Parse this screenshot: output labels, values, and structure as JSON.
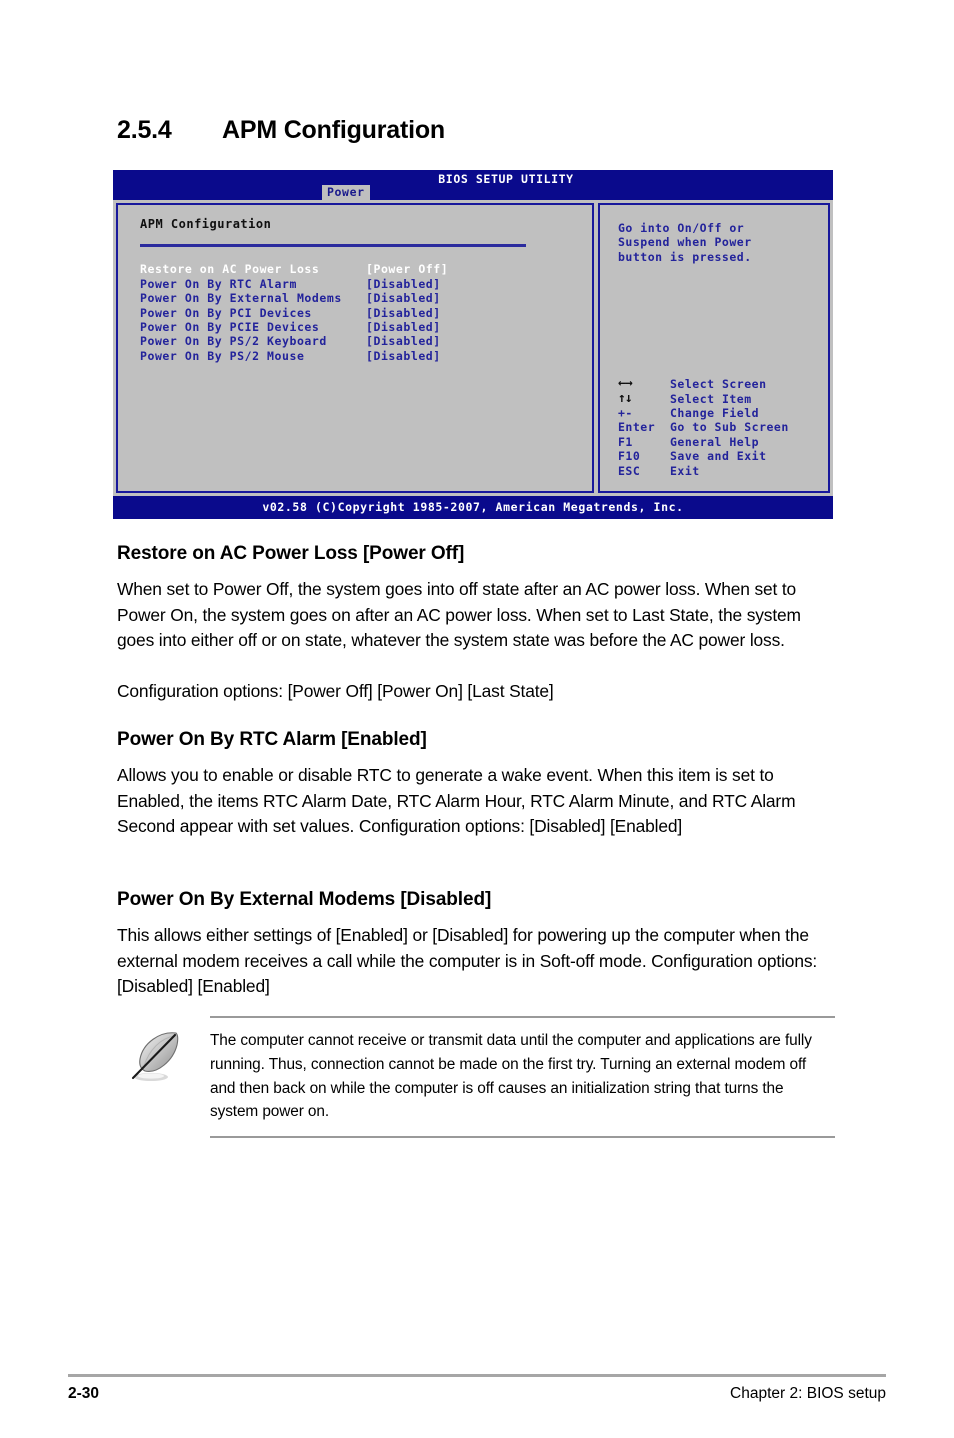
{
  "page": {
    "heading_number": "2.5.4",
    "heading_title": "APM Configuration"
  },
  "bios": {
    "title": "BIOS SETUP UTILITY",
    "tab": "Power",
    "section_title": "APM Configuration",
    "options": [
      {
        "label": "Restore on AC Power Loss",
        "value": "[Power Off]",
        "selected": true
      },
      {
        "label": "Power On By RTC Alarm",
        "value": "[Disabled]",
        "selected": false
      },
      {
        "label": "Power On By External Modems",
        "value": "[Disabled]",
        "selected": false
      },
      {
        "label": "Power On By PCI Devices",
        "value": "[Disabled]",
        "selected": false
      },
      {
        "label": "Power On By PCIE Devices",
        "value": "[Disabled]",
        "selected": false
      },
      {
        "label": "Power On By PS/2 Keyboard",
        "value": "[Disabled]",
        "selected": false
      },
      {
        "label": "Power On By PS/2 Mouse",
        "value": "[Disabled]",
        "selected": false
      }
    ],
    "help_lines": [
      "Go into On/Off or",
      "Suspend when Power",
      "button is pressed."
    ],
    "legend": [
      {
        "key": "←→",
        "desc": "Select Screen",
        "glyph": true
      },
      {
        "key": "↑↓",
        "desc": "Select Item",
        "glyph": true
      },
      {
        "key": "+-",
        "desc": "Change Field",
        "glyph": false
      },
      {
        "key": "Enter",
        "desc": "Go to Sub Screen",
        "glyph": false
      },
      {
        "key": "F1",
        "desc": "General Help",
        "glyph": false
      },
      {
        "key": "F10",
        "desc": "Save and Exit",
        "glyph": false
      },
      {
        "key": "ESC",
        "desc": "Exit",
        "glyph": false
      }
    ],
    "copyright": "v02.58 (C)Copyright 1985-2007, American Megatrends, Inc.",
    "colors": {
      "header_blue": "#0a0a8c",
      "panel_gray": "#c0c0c0",
      "text_blue": "#23239b",
      "selected_white": "#ffffff"
    }
  },
  "sections": [
    {
      "heading": "Restore on AC Power Loss [Power Off]",
      "body": "When set to Power Off, the system goes into off state after an AC power loss. When set to Power On, the system goes on after an AC power loss. When set to Last State, the system goes into either off or on state, whatever the system state was before the AC power loss.",
      "options_line": "Configuration options: [Power Off] [Power On] [Last State]"
    },
    {
      "heading": "Power On By RTC Alarm [Enabled]",
      "body": "Allows you to enable or disable RTC to generate a wake event. When this item is set to Enabled, the items RTC Alarm Date, RTC Alarm Hour, RTC Alarm Minute, and RTC Alarm Second appear with set values. Configuration options: [Disabled] [Enabled]",
      "options_line": ""
    },
    {
      "heading": "Power On By External Modems [Disabled]",
      "body": "This allows either settings of [Enabled] or [Disabled] for powering up the computer when the external modem receives a call while the computer is in Soft-off mode. Configuration options: [Disabled] [Enabled]",
      "options_line": ""
    }
  ],
  "note": {
    "icon": "quill-pen-icon",
    "text": "The computer cannot receive or transmit data until the computer and applications are fully running. Thus, connection cannot be made on the first try. Turning an external modem off and then back on while the computer is off causes an initialization string that turns the system power on."
  },
  "footer": {
    "page_number": "2-30",
    "chapter": "Chapter 2: BIOS setup"
  }
}
